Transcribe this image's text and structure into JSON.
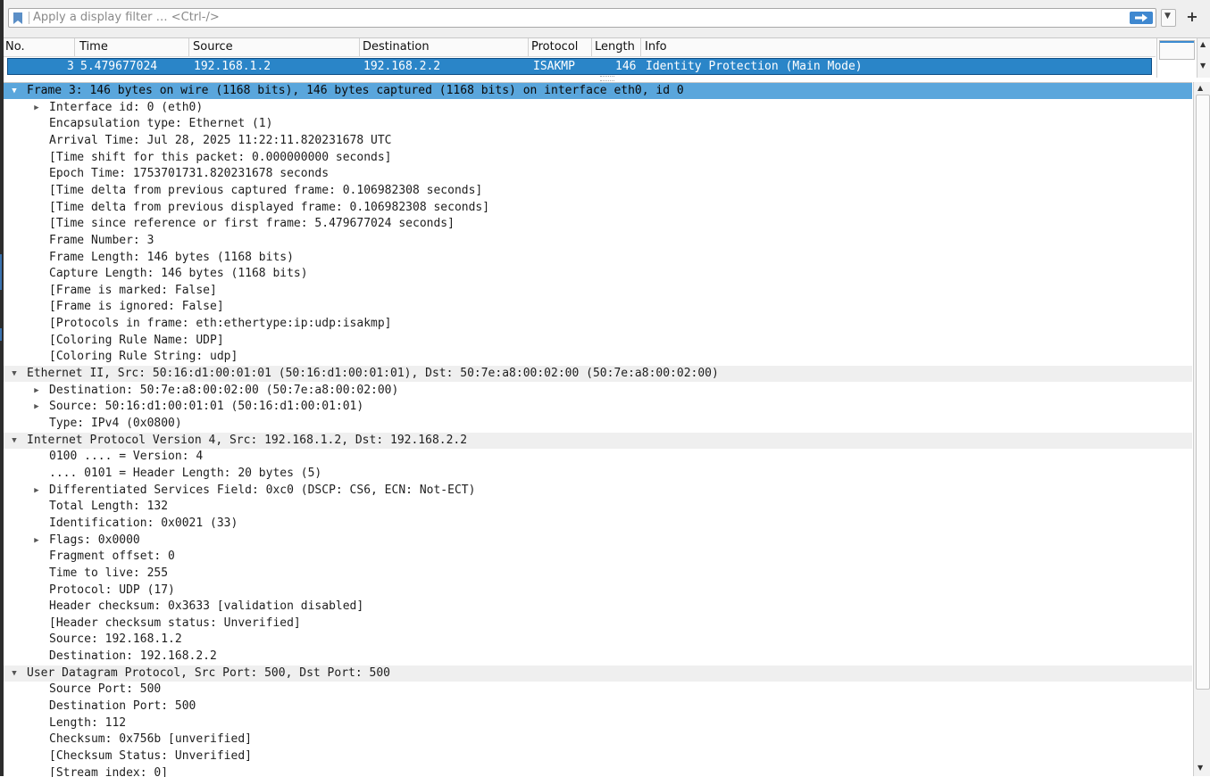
{
  "filter": {
    "placeholder": "Apply a display filter … <Ctrl-/>",
    "plus_label": "+"
  },
  "packet_list": {
    "columns": [
      "No.",
      "Time",
      "Source",
      "Destination",
      "Protocol",
      "Length",
      "Info"
    ],
    "selected_row": {
      "no": "3",
      "time": "5.479677024",
      "source": "192.168.1.2",
      "destination": "192.168.2.2",
      "protocol": "ISAKMP",
      "length": "146",
      "info": "Identity Protection (Main Mode)"
    }
  },
  "details": [
    {
      "text": "Frame 3: 146 bytes on wire (1168 bits), 146 bytes captured (1168 bits) on interface eth0, id 0",
      "level": 0,
      "toggle": "expanded",
      "selected": true
    },
    {
      "text": "Interface id: 0 (eth0)",
      "level": 1,
      "toggle": "collapsed"
    },
    {
      "text": "Encapsulation type: Ethernet (1)",
      "level": 1
    },
    {
      "text": "Arrival Time: Jul 28, 2025 11:22:11.820231678 UTC",
      "level": 1
    },
    {
      "text": "[Time shift for this packet: 0.000000000 seconds]",
      "level": 1
    },
    {
      "text": "Epoch Time: 1753701731.820231678 seconds",
      "level": 1
    },
    {
      "text": "[Time delta from previous captured frame: 0.106982308 seconds]",
      "level": 1
    },
    {
      "text": "[Time delta from previous displayed frame: 0.106982308 seconds]",
      "level": 1
    },
    {
      "text": "[Time since reference or first frame: 5.479677024 seconds]",
      "level": 1
    },
    {
      "text": "Frame Number: 3",
      "level": 1
    },
    {
      "text": "Frame Length: 146 bytes (1168 bits)",
      "level": 1
    },
    {
      "text": "Capture Length: 146 bytes (1168 bits)",
      "level": 1
    },
    {
      "text": "[Frame is marked: False]",
      "level": 1
    },
    {
      "text": "[Frame is ignored: False]",
      "level": 1
    },
    {
      "text": "[Protocols in frame: eth:ethertype:ip:udp:isakmp]",
      "level": 1
    },
    {
      "text": "[Coloring Rule Name: UDP]",
      "level": 1
    },
    {
      "text": "[Coloring Rule String: udp]",
      "level": 1
    },
    {
      "text": "Ethernet II, Src: 50:16:d1:00:01:01 (50:16:d1:00:01:01), Dst: 50:7e:a8:00:02:00 (50:7e:a8:00:02:00)",
      "level": 0,
      "toggle": "expanded"
    },
    {
      "text": "Destination: 50:7e:a8:00:02:00 (50:7e:a8:00:02:00)",
      "level": 1,
      "toggle": "collapsed"
    },
    {
      "text": "Source: 50:16:d1:00:01:01 (50:16:d1:00:01:01)",
      "level": 1,
      "toggle": "collapsed"
    },
    {
      "text": "Type: IPv4 (0x0800)",
      "level": 1
    },
    {
      "text": "Internet Protocol Version 4, Src: 192.168.1.2, Dst: 192.168.2.2",
      "level": 0,
      "toggle": "expanded"
    },
    {
      "text": "0100 .... = Version: 4",
      "level": 1
    },
    {
      "text": ".... 0101 = Header Length: 20 bytes (5)",
      "level": 1
    },
    {
      "text": "Differentiated Services Field: 0xc0 (DSCP: CS6, ECN: Not-ECT)",
      "level": 1,
      "toggle": "collapsed"
    },
    {
      "text": "Total Length: 132",
      "level": 1
    },
    {
      "text": "Identification: 0x0021 (33)",
      "level": 1
    },
    {
      "text": "Flags: 0x0000",
      "level": 1,
      "toggle": "collapsed"
    },
    {
      "text": "Fragment offset: 0",
      "level": 1
    },
    {
      "text": "Time to live: 255",
      "level": 1
    },
    {
      "text": "Protocol: UDP (17)",
      "level": 1
    },
    {
      "text": "Header checksum: 0x3633 [validation disabled]",
      "level": 1
    },
    {
      "text": "[Header checksum status: Unverified]",
      "level": 1
    },
    {
      "text": "Source: 192.168.1.2",
      "level": 1
    },
    {
      "text": "Destination: 192.168.2.2",
      "level": 1
    },
    {
      "text": "User Datagram Protocol, Src Port: 500, Dst Port: 500",
      "level": 0,
      "toggle": "expanded"
    },
    {
      "text": "Source Port: 500",
      "level": 1
    },
    {
      "text": "Destination Port: 500",
      "level": 1
    },
    {
      "text": "Length: 112",
      "level": 1
    },
    {
      "text": "Checksum: 0x756b [unverified]",
      "level": 1
    },
    {
      "text": "[Checksum Status: Unverified]",
      "level": 1
    },
    {
      "text": "[Stream index: 0]",
      "level": 1
    }
  ],
  "colors": {
    "selected_row": "#2a85c8",
    "selected_tree_item": "#5aa6dc",
    "section_header": "#efefef",
    "apply_button": "#3f88d0"
  }
}
